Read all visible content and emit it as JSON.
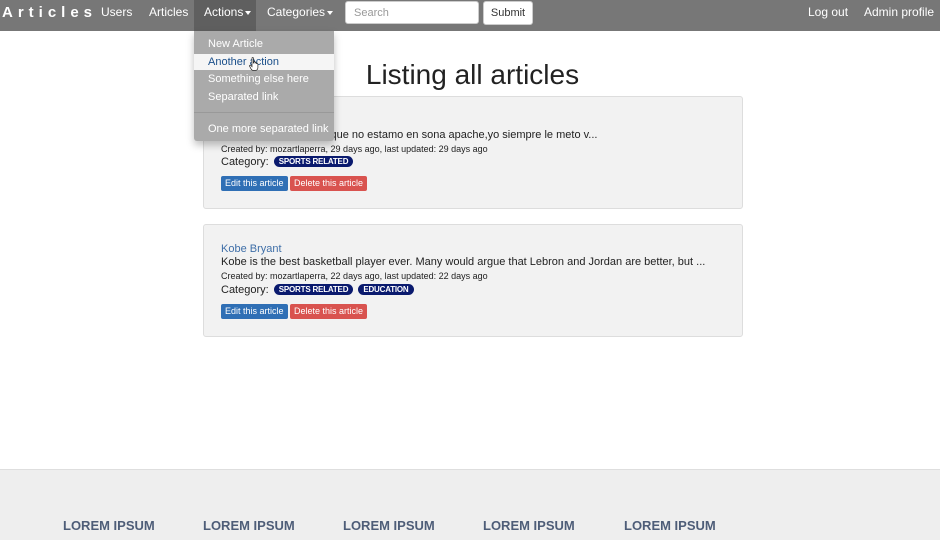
{
  "navbar": {
    "brand": "Articles",
    "links": {
      "users": "Users",
      "articles": "Articles",
      "actions": "Actions",
      "categories": "Categories"
    },
    "search_placeholder": "Search",
    "submit_label": "Submit",
    "logout": "Log out",
    "admin_profile": "Admin profile"
  },
  "dropdown": {
    "items": [
      "New Article",
      "Another action",
      "Something else here",
      "Separated link",
      "One more separated link"
    ],
    "active_index": 1
  },
  "page_title": "Listing all articles",
  "articles": [
    {
      "title": "",
      "description": "no tarjeta th, tranquilo que no estamo en sona apache,yo siempre le meto v...",
      "meta": "Created by: mozartlaperra, 29 days ago, last updated: 29 days ago",
      "category_label": "Category:",
      "categories": [
        "SPORTS RELATED"
      ],
      "edit_label": "Edit this article",
      "delete_label": "Delete this article"
    },
    {
      "title": "Kobe Bryant",
      "description": "Kobe is the best basketball player ever. Many would argue that Lebron and Jordan are better, but ...",
      "meta": "Created by: mozartlaperra, 22 days ago, last updated: 22 days ago",
      "category_label": "Category:",
      "categories": [
        "SPORTS RELATED",
        "EDUCATION"
      ],
      "edit_label": "Edit this article",
      "delete_label": "Delete this article"
    }
  ],
  "footer": {
    "headings": [
      "LOREM IPSUM",
      "LOREM IPSUM",
      "LOREM IPSUM",
      "LOREM IPSUM",
      "LOREM IPSUM"
    ]
  },
  "colors": {
    "navbar": "#777777",
    "link": "#3f6fa8",
    "badge": "#0a1a6e",
    "edit_button": "#2f6fb5",
    "delete_button": "#d9534f",
    "footer_heading": "#4e5d78"
  }
}
